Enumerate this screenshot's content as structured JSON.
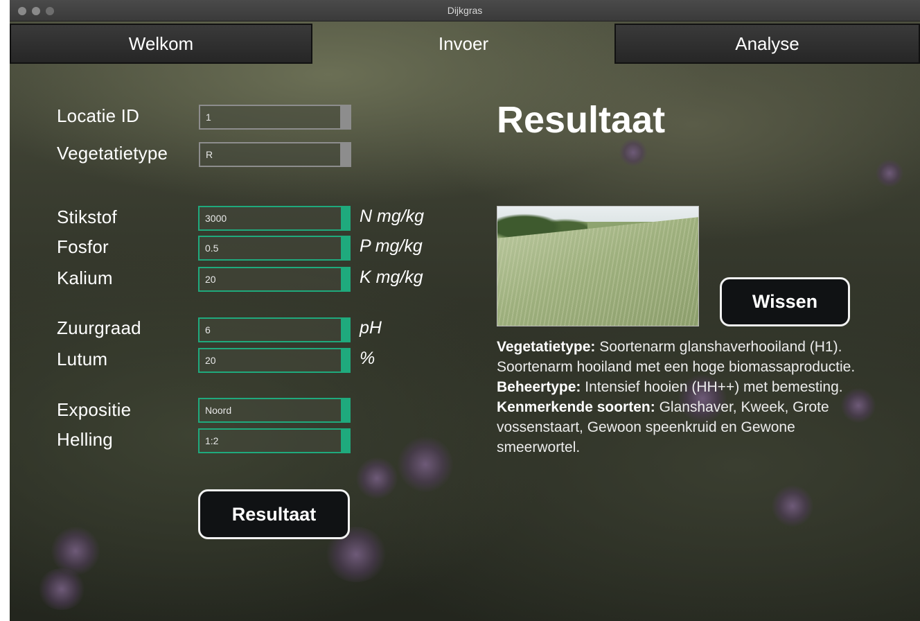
{
  "window": {
    "title": "Dijkgras"
  },
  "tabs": [
    {
      "label": "Welkom",
      "active": false
    },
    {
      "label": "Invoer",
      "active": true
    },
    {
      "label": "Analyse",
      "active": false
    }
  ],
  "form": {
    "locatie_id": {
      "label": "Locatie ID",
      "value": "1"
    },
    "vegetatietype": {
      "label": "Vegetatietype",
      "value": "R"
    },
    "stikstof": {
      "label": "Stikstof",
      "value": "3000",
      "unit": "N mg/kg"
    },
    "fosfor": {
      "label": "Fosfor",
      "value": "0.5",
      "unit": "P mg/kg"
    },
    "kalium": {
      "label": "Kalium",
      "value": "20",
      "unit": "K mg/kg"
    },
    "zuurgraad": {
      "label": "Zuurgraad",
      "value": "6",
      "unit": "pH"
    },
    "lutum": {
      "label": "Lutum",
      "value": "20",
      "unit": "%"
    },
    "expositie": {
      "label": "Expositie",
      "value": "Noord"
    },
    "helling": {
      "label": "Helling",
      "value": "1:2"
    },
    "submit_label": "Resultaat"
  },
  "result": {
    "heading": "Resultaat",
    "clear_label": "Wissen",
    "vegetatietype_label": "Vegetatietype:",
    "vegetatietype_text": "Soortenarm glanshaverhooiland (H1). Soortenarm hooiland met een hoge biomassaproductie.",
    "beheertype_label": "Beheertype:",
    "beheertype_text": "Intensief hooien (HH++) met bemesting.",
    "soorten_label": "Kenmerkende soorten:",
    "soorten_text": "Glanshaver, Kweek, Grote vossenstaart, Gewoon speenkruid en Gewone smeerwortel."
  },
  "colors": {
    "accent_green": "#1faa7d",
    "field_gray": "#8d8d8d",
    "button_bg": "#101214"
  }
}
